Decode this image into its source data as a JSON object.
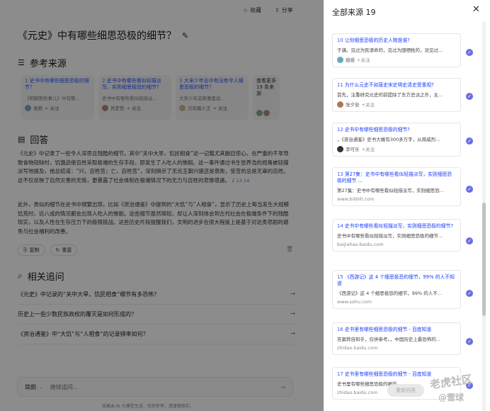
{
  "topbar": {
    "collect_label": "收藏",
    "share_label": "分享"
  },
  "title": "《元史》中有哪些细思恐极的细节？",
  "refs": {
    "heading": "参考来源",
    "cards": [
      {
        "num": "1",
        "title": "史书中有哪些细思恐极的细节？",
        "desc": "《明朝那些事儿》中有哪...",
        "author": "张雨"
      },
      {
        "num": "2",
        "title": "史书中有哪些看似轻描淡写，实则细思极恐的细节？",
        "desc": "史书中有哪些看似轻描淡...",
        "author": "肖定哲"
      },
      {
        "num": "3",
        "title": "大宋少年志中有没有令人细思恐极的细节？",
        "desc": "大宋少年志原著里说...",
        "author": "万年路人王"
      }
    ],
    "more_label": "查看更多 19 条来源",
    "follow_label": "+ 关注"
  },
  "answer": {
    "heading": "回答",
    "p1": "《元史》中记录了一些令人深思且残酷的细节。其中“关中大旱，饥民相食”这一记载尤其触目惊心。在严重的干旱导致食物短缺时，饥饿迫使百姓采取极端的生存手段，即发生了人吃人的惨剧。这一事件通过书生张养浩的视角被轻描淡写地提及，他总结道：“兴，百姓苦；亡，百姓苦”，深刻揭示了无论王朝兴盛还是衰败，受苦的总是无辜的百姓。这不仅反映了自然灾害的无情，更暴露了社会体制在极端情况下的无力与百姓的悲惨境遇。",
    "p1_refs": "2 13 14",
    "p2": "此外，类似的细节在史书中频繁出现，比如《资治通鉴》中提到的“大饥”与“人相食”，显示了历史上每当发生大规模饥荒时，近八成的情况都会出现人吃人的惨剧。这些细节虽然简短，却让人深刻体会到古代社会在极端条件下的残酷现实，以及人性在生存压力下的极限挑战。这些历史片段提醒我们，文明的进步在很大程度上是基于对这类悲剧的避免与社会福利的改善。",
    "copy_label": "复制",
    "regen_label": "重复"
  },
  "related": {
    "heading": "相关追问",
    "items": [
      "《元史》中记录的“关中大旱，饥民相食”细节有多恐怖？",
      "历史上一些少数民族政权的覆灭是如何形成的？",
      "《资治通鉴》中“大饥”与“人相食”的记录频率如何？"
    ]
  },
  "input": {
    "mode": "简朗",
    "placeholder": "继续追问..."
  },
  "footer": "结果由 AI 大模型生成，仅供参考，请谨慎核实。",
  "panel": {
    "title": "全部来源 19",
    "regenerate_label": "重新回答",
    "sources": [
      {
        "num": "10",
        "title": "让你细思恐极的历史人物是谁?",
        "desc": "于谦。见过为民请命的，见过为国牺牲的，没见过...",
        "author": "煜煜",
        "follow": "+关注"
      },
      {
        "num": "11",
        "title": "为什么元史不如唐史宋史明史清史受重视?",
        "desc": "首先，注重研究元史的前提除了东方史派之外，主...",
        "author": "张夕安",
        "follow": "+关注"
      },
      {
        "num": "12",
        "title": "史书中有哪些细思恐极的细节?",
        "desc": "，《资治通鉴》史书大概有300多万字，从周威烈...",
        "author": "李可乐",
        "follow": "+关注"
      },
      {
        "num": "13",
        "title": "第27集：史书中有哪些看似轻描淡写，实则细思恐极的细节 ...",
        "desc": "第27集：史书中有哪些看似轻描淡写，实则细思恐...",
        "site": "www.bilibili.com"
      },
      {
        "num": "14",
        "title": "史书中有哪些看似轻描淡写，实则细思恐极的细节?",
        "desc": "史书中有哪些看似轻描淡写，实则细思恐极的细节...",
        "site": "baijiahao.baidu.com"
      },
      {
        "num": "15",
        "title": "《西游记》这 4 个细思极恐的细节，99% 的人不知道",
        "desc": "《西游记》这 4 个细思极恐的细节，99% 的人不...",
        "site": "www.sohu.com"
      },
      {
        "num": "16",
        "title": "史书里有哪些细思恐极的细节 - 百度知道",
        "desc": "答案转自知乎，仅供参考。，中国历史上最恐怖的...",
        "site": "zhidao.baidu.com"
      },
      {
        "num": "17",
        "title": "史书里有哪些细思恐极的细节 - 百度知道",
        "desc": "史书里有哪些细思恐极的细节",
        "site": "zhidao.baidu.com"
      }
    ]
  },
  "watermark": {
    "line1": "老虎社区",
    "line2": "@雪球"
  },
  "colors": {
    "accent": "#6a6fe0",
    "link": "#1a3cff",
    "overlay": "rgba(0,0,0,0.45)"
  }
}
